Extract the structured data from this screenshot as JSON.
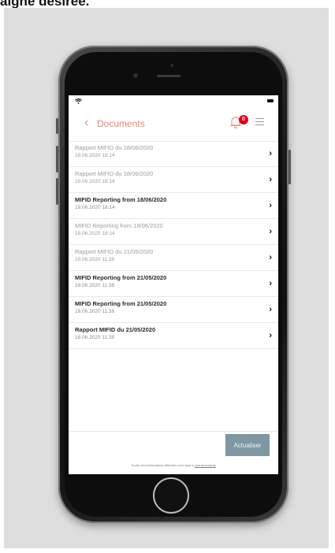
{
  "caption": "aigne désirée.",
  "header": {
    "back_glyph": "‹",
    "title": "Documents",
    "notification_count": "0"
  },
  "documents": [
    {
      "title": "Rapport MIFID du 18/06/2020",
      "date": "18.06.2020 18:14",
      "unread": false
    },
    {
      "title": "Rapport MIFID du 18/06/2020",
      "date": "18.06.2020 18:14",
      "unread": false
    },
    {
      "title": "MIFID Reporting from 18/06/2020",
      "date": "18.06.2020 18:14",
      "unread": true
    },
    {
      "title": "MIFID Reporting from 18/06/2020",
      "date": "18.06.2020 18:14",
      "unread": false
    },
    {
      "title": "Rapport MIFID du 21/05/2020",
      "date": "18.06.2020 11:38",
      "unread": false
    },
    {
      "title": "MIFID Reporting from 21/05/2020",
      "date": "18.06.2020 11:38",
      "unread": true
    },
    {
      "title": "MIFID Reporting from 21/05/2020",
      "date": "18.06.2020 11:38",
      "unread": true
    },
    {
      "title": "Rapport MIFID du 21/05/2020",
      "date": "18.06.2020 11:38",
      "unread": true
    }
  ],
  "actions": {
    "refresh_label": "Actualiser"
  },
  "disclaimer": {
    "text": "Toutes les informations affichées sont sujet à ",
    "link": "avertissements"
  },
  "icons": {
    "chevron": "›",
    "wifi": "wifi-icon",
    "battery": "battery-icon",
    "bell": "bell-icon",
    "menu": "hamburger-menu-icon"
  },
  "colors": {
    "accent": "#e08a7e",
    "badge": "#e0001b",
    "button": "#7f97a3"
  }
}
